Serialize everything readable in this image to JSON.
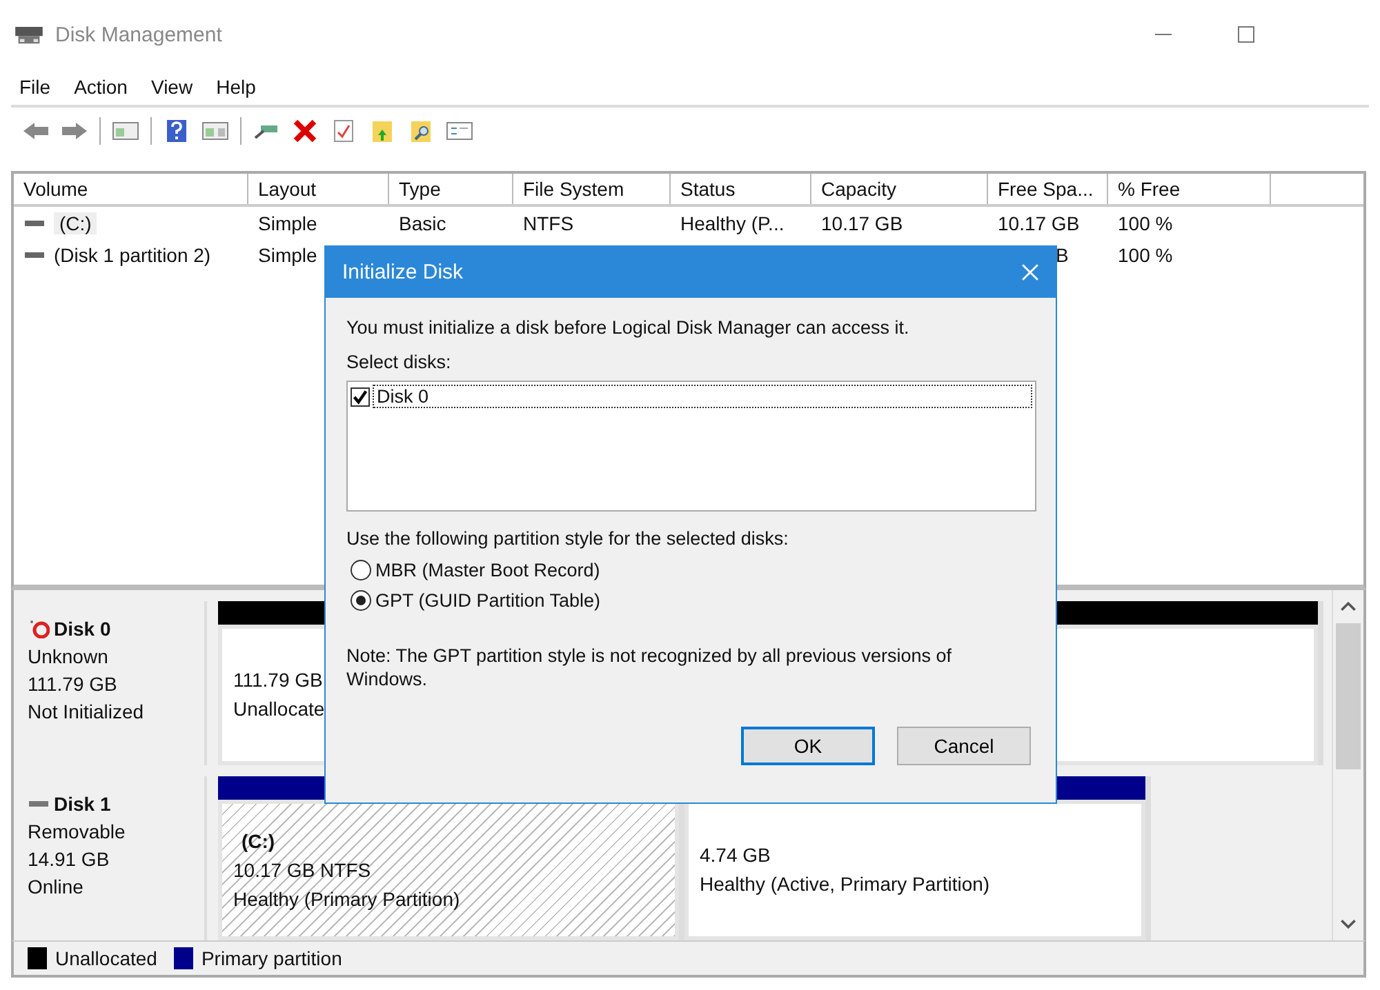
{
  "window": {
    "title": "Disk Management"
  },
  "menu": [
    "File",
    "Action",
    "View",
    "Help"
  ],
  "table": {
    "columns": [
      "Volume",
      "Layout",
      "Type",
      "File System",
      "Status",
      "Capacity",
      "Free Spa...",
      "% Free"
    ],
    "rows": [
      {
        "selected": true,
        "cells": [
          "(C:)",
          "Simple",
          "Basic",
          "NTFS",
          "Healthy (P...",
          "10.17 GB",
          "10.17 GB",
          "100 %"
        ]
      },
      {
        "selected": false,
        "cells": [
          "(Disk 1 partition 2)",
          "Simple",
          null,
          null,
          null,
          null,
          "B",
          "100 %"
        ]
      }
    ]
  },
  "disks": [
    {
      "name": "Disk 0",
      "kind": "error",
      "type": "Unknown",
      "size": "111.79 GB",
      "state": "Not Initialized",
      "partitions": [
        {
          "kind": "unallocated",
          "selected": false,
          "lines": [
            "111.79 GB",
            "Unallocate"
          ]
        }
      ]
    },
    {
      "name": "Disk 1",
      "kind": "removable",
      "type": "Removable",
      "size": "14.91 GB",
      "state": "Online",
      "partitions": [
        {
          "kind": "primary",
          "selected": true,
          "label": "(C:)",
          "lines": [
            "10.17 GB NTFS",
            "Healthy (Primary Partition)"
          ]
        },
        {
          "kind": "primary",
          "selected": false,
          "lines": [
            "4.74 GB",
            "Healthy (Active, Primary Partition)"
          ]
        }
      ]
    }
  ],
  "legend": [
    {
      "label": "Unallocated",
      "color": "#000000"
    },
    {
      "label": "Primary partition",
      "color": "#00008b"
    }
  ],
  "dialog": {
    "title": "Initialize Disk",
    "message": "You must initialize a disk before Logical Disk Manager can access it.",
    "select_label": "Select disks:",
    "disks": [
      {
        "label": "Disk 0",
        "checked": true
      }
    ],
    "style_label": "Use the following partition style for the selected disks:",
    "styles": [
      {
        "label": "MBR (Master Boot Record)",
        "selected": false
      },
      {
        "label": "GPT (GUID Partition Table)",
        "selected": true
      }
    ],
    "note": "Note: The GPT partition style is not recognized by all previous versions of Windows.",
    "buttons": [
      {
        "label": "OK",
        "default": true
      },
      {
        "label": "Cancel",
        "default": false
      }
    ]
  }
}
